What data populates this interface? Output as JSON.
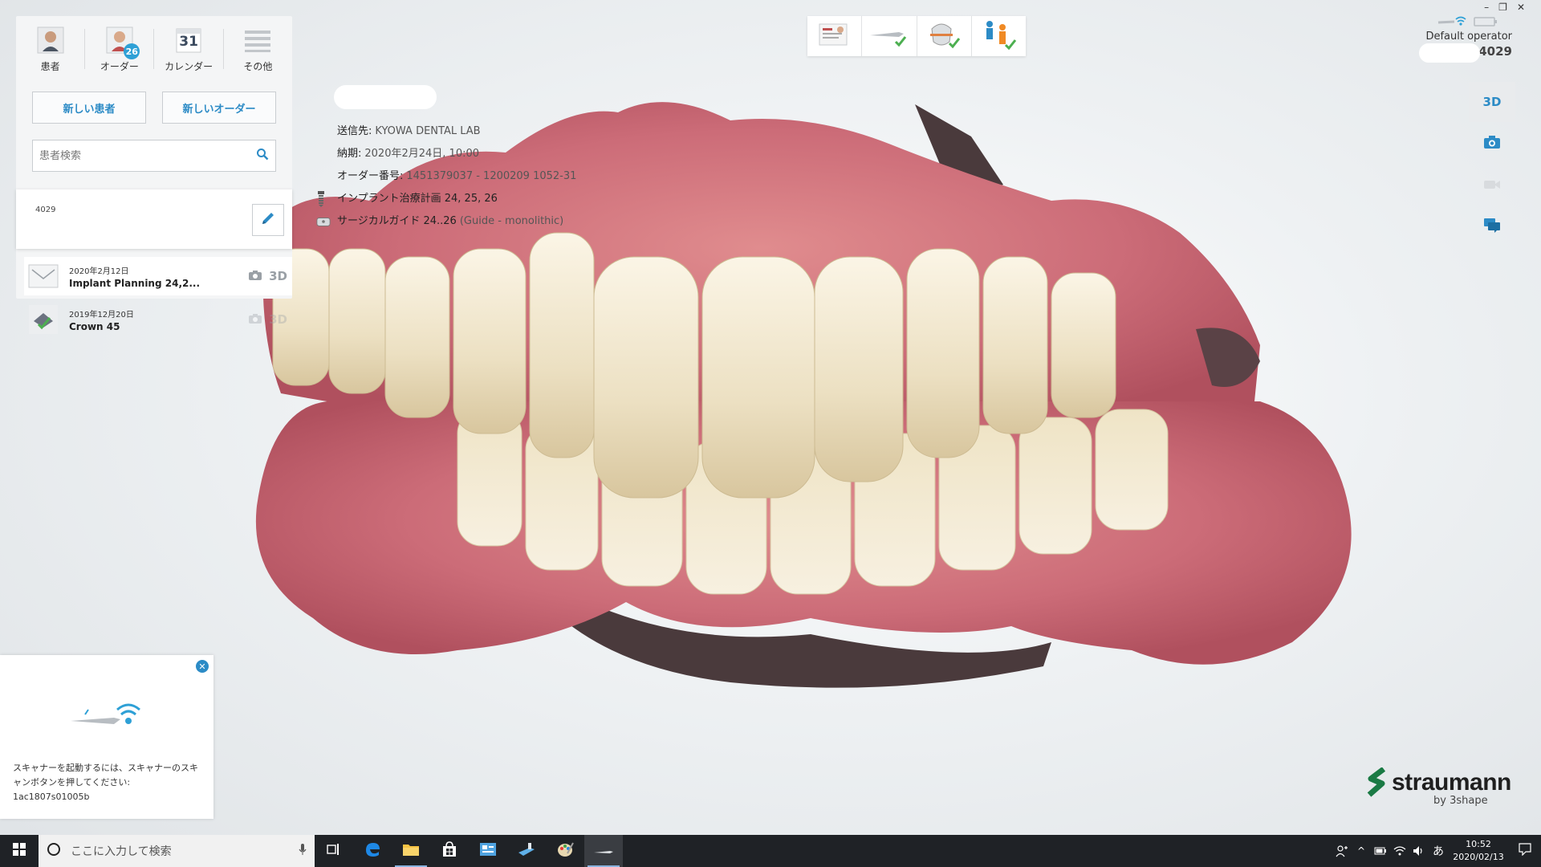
{
  "nav": {
    "patients_label": "患者",
    "orders_label": "オーダー",
    "orders_badge": "26",
    "calendar_label": "カレンダー",
    "calendar_day": "31",
    "more_label": "その他"
  },
  "actions": {
    "new_patient": "新しい患者",
    "new_order": "新しいオーダー"
  },
  "search": {
    "placeholder": "患者検索"
  },
  "patient": {
    "id": "4029"
  },
  "orders": [
    {
      "date": "2020年2月12日",
      "title": "Implant Planning 24,2...",
      "tag": "3D"
    },
    {
      "date": "2019年12月20日",
      "title": "Crown 45",
      "tag": "3D"
    }
  ],
  "order_info": {
    "send_to_label": "送信先:",
    "send_to_value": "KYOWA DENTAL LAB",
    "due_label": "納期:",
    "due_value": "2020年2月24日, 10:00",
    "order_no_label": "オーダー番号:",
    "order_no_value": "1451379037 - 1200209 1052-31",
    "implant_plan": "インプラント治療計画 24, 25, 26",
    "surgical_guide_label": "サージカルガイド 24..26",
    "surgical_guide_value": "(Guide - monolithic)"
  },
  "operator": {
    "name": "Default operator",
    "patient_id": "4029"
  },
  "right_toolbar": {
    "view_3d": "3D"
  },
  "scanner_note": {
    "message": "スキャナーを起動するには、スキャナーのスキャンボタンを押してください:",
    "serial": "1ac1807s01005b"
  },
  "logo": {
    "brand": "straumann",
    "by": "by 3shape"
  },
  "taskbar": {
    "search_placeholder": "ここに入力して検索",
    "ime": "あ",
    "time": "10:52",
    "date": "2020/02/13"
  },
  "colors": {
    "accent": "#2c8bc6",
    "badge": "#2ea0d6",
    "gum": "#c8646e",
    "tooth": "#f0e6cc",
    "taskbar": "#1f2226"
  }
}
